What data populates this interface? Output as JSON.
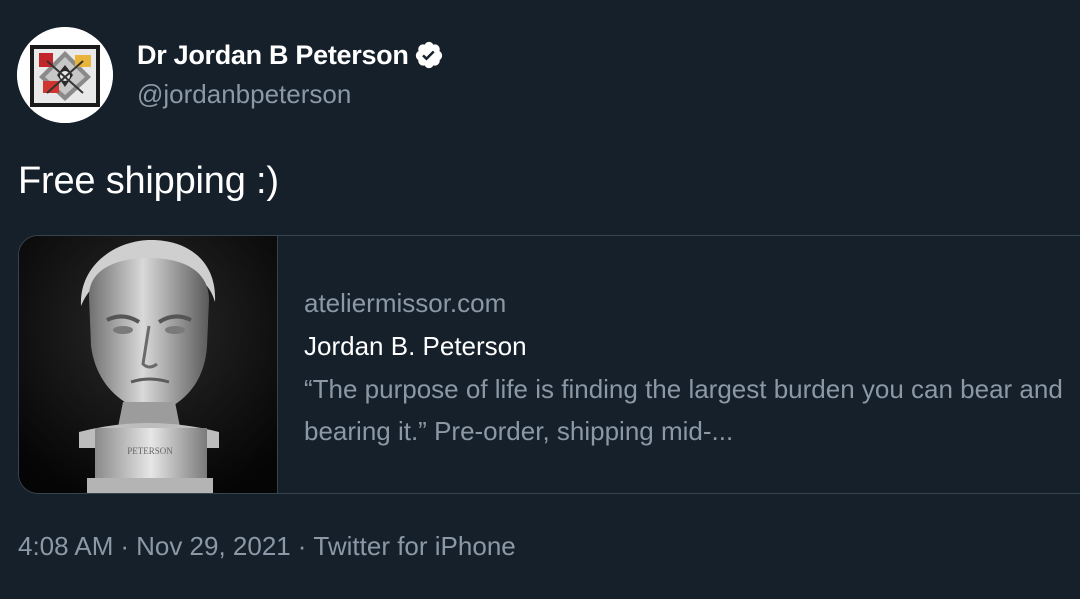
{
  "author": {
    "display_name": "Dr Jordan B Peterson",
    "handle": "@jordanbpeterson",
    "avatar_icon": "maps-of-meaning-logo-icon",
    "verified_icon": "verified-badge-icon"
  },
  "tweet": {
    "text": "Free shipping :)"
  },
  "card": {
    "domain": "ateliermissor.com",
    "title": "Jordan B. Peterson",
    "description": "“The purpose of life is finding the largest burden you can bear and bearing it.” Pre-order, shipping mid-...",
    "image_icon": "bust-sculpture-image",
    "plinth_text": "PETERSON"
  },
  "meta": {
    "time": "4:08 AM",
    "date": "Nov 29, 2021",
    "source": "Twitter for iPhone",
    "separator": "·"
  },
  "colors": {
    "background": "#15202b",
    "primary_text": "#ffffff",
    "secondary_text": "#8b98a5",
    "border": "#38444d"
  }
}
